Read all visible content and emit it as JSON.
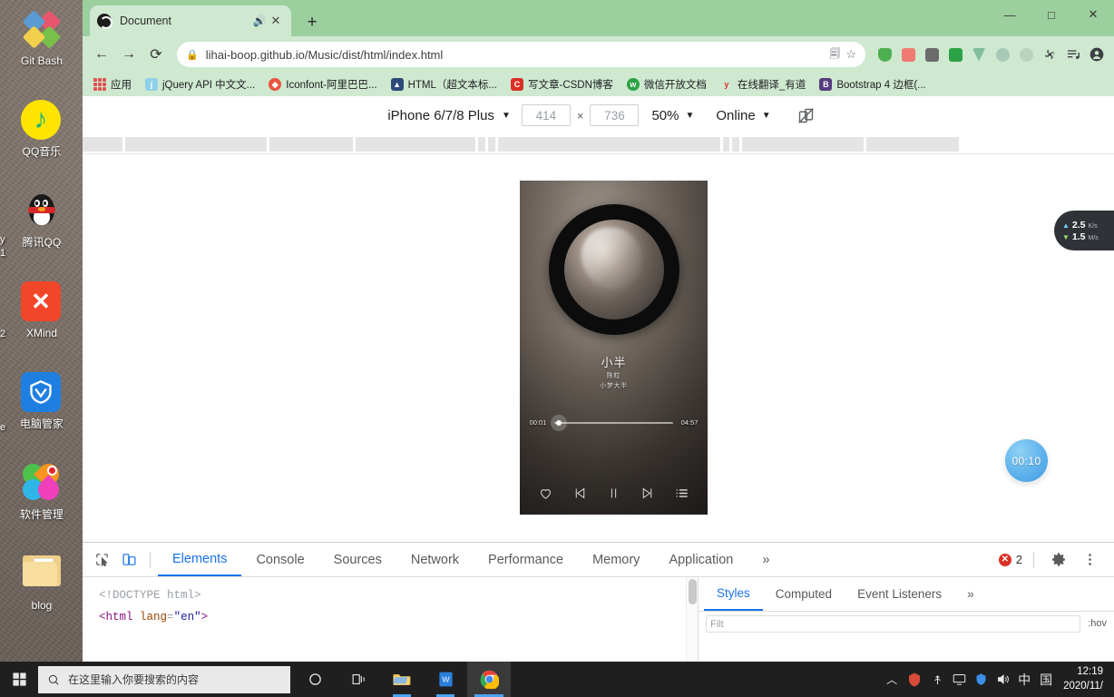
{
  "desktop": {
    "icons": [
      {
        "name": "git-bash",
        "label": "Git Bash"
      },
      {
        "name": "qq-music",
        "label": "QQ音乐"
      },
      {
        "name": "tencent-qq",
        "label": "腾讯QQ"
      },
      {
        "name": "xmind",
        "label": "XMind"
      },
      {
        "name": "pc-manager",
        "label": "电脑管家"
      },
      {
        "name": "software-manager",
        "label": "软件管理"
      },
      {
        "name": "blog-folder",
        "label": "blog"
      }
    ],
    "stray_labels": [
      "y",
      "1",
      "2",
      "e"
    ]
  },
  "overlays": {
    "network": {
      "upload_value": "2.5",
      "upload_unit": "K/s",
      "download_value": "1.5",
      "download_unit": "M/s"
    },
    "timer": {
      "value": "00:10"
    }
  },
  "browser": {
    "tab": {
      "title": "Document",
      "audio_icon": "speaker-icon",
      "close_icon": "close-icon"
    },
    "new_tab_label": "+",
    "window_controls": {
      "minimize": "—",
      "maximize": "□",
      "close": "✕"
    },
    "nav": {
      "back": "←",
      "forward": "→",
      "reload": "⟳"
    },
    "omnibox": {
      "lock_icon": "lock-icon",
      "url": "lihai-boop.github.io/Music/dist/html/index.html",
      "translate_icon": "translate-icon",
      "star_icon": "star-icon"
    },
    "extensions": [
      {
        "name": "adguard-icon",
        "color": "#4caf50"
      },
      {
        "name": "bookmark-ext-icon",
        "color": "#ef7b72"
      },
      {
        "name": "search-ext-icon",
        "color": "#6b6b6b"
      },
      {
        "name": "wechat-ext-icon",
        "color": "#2ba245"
      },
      {
        "name": "vue-devtools-icon",
        "color": "#7fbf9a"
      },
      {
        "name": "react-devtools-icon",
        "color": "#a9c9b8"
      },
      {
        "name": "generic-ext-icon",
        "color": "#b9d3bd"
      },
      {
        "name": "puzzle-icon",
        "color": "#3c4043"
      },
      {
        "name": "media-list-icon",
        "color": "#3c4043"
      },
      {
        "name": "profile-avatar-icon",
        "color": "#3c4043"
      }
    ],
    "bookmarks": [
      {
        "name": "apps",
        "label": "应用",
        "icon": "apps-grid-icon",
        "color": "#e0534f"
      },
      {
        "name": "jquery-api",
        "label": "jQuery API 中文文...",
        "icon": "jquery-icon",
        "color": "#8fd0e8"
      },
      {
        "name": "iconfont",
        "label": "Iconfont-阿里巴巴...",
        "icon": "iconfont-icon",
        "color": "#e8543f"
      },
      {
        "name": "html-mdn",
        "label": "HTML（超文本标...",
        "icon": "html-icon",
        "color": "#2d4a7a"
      },
      {
        "name": "csdn",
        "label": "写文章-CSDN博客",
        "icon": "csdn-icon",
        "color": "#d93025"
      },
      {
        "name": "wechat-docs",
        "label": "微信开放文档",
        "icon": "wechat-icon",
        "color": "#2ba245"
      },
      {
        "name": "youdao",
        "label": "在线翻译_有道",
        "icon": "youdao-icon",
        "color": "#d93025"
      },
      {
        "name": "bootstrap",
        "label": "Bootstrap 4 边框(...",
        "icon": "bootstrap-icon",
        "color": "#563d7c"
      }
    ]
  },
  "device_toolbar": {
    "device": "iPhone 6/7/8 Plus",
    "width": "414",
    "height": "736",
    "separator": "×",
    "zoom": "50%",
    "throttling": "Online",
    "rotate_icon": "rotate-device-icon"
  },
  "player": {
    "title": "小半",
    "artist": "陈粒",
    "album": "小梦大半",
    "current_time": "00:01",
    "total_time": "04:57",
    "progress_percent": 1,
    "controls": [
      {
        "name": "favorite-button",
        "icon": "heart-icon"
      },
      {
        "name": "previous-button",
        "icon": "skip-previous-icon"
      },
      {
        "name": "play-pause-button",
        "icon": "pause-icon"
      },
      {
        "name": "next-button",
        "icon": "skip-next-icon"
      },
      {
        "name": "playlist-button",
        "icon": "playlist-icon"
      }
    ]
  },
  "devtools": {
    "inspect_icon": "inspect-element-icon",
    "device_toggle_icon": "device-toolbar-icon",
    "tabs": [
      {
        "name": "elements",
        "label": "Elements",
        "active": true
      },
      {
        "name": "console",
        "label": "Console",
        "active": false
      },
      {
        "name": "sources",
        "label": "Sources",
        "active": false
      },
      {
        "name": "network",
        "label": "Network",
        "active": false
      },
      {
        "name": "performance",
        "label": "Performance",
        "active": false
      },
      {
        "name": "memory",
        "label": "Memory",
        "active": false
      },
      {
        "name": "application",
        "label": "Application",
        "active": false
      }
    ],
    "more_tabs_label": "»",
    "error_count": "2",
    "settings_icon": "gear-icon",
    "menu_icon": "kebab-menu-icon",
    "dom": {
      "line1": "<!DOCTYPE html>",
      "line2_open": "<",
      "line2_tag": "html",
      "line2_attr": " lang",
      "line2_eq": "=",
      "line2_val": "\"en\"",
      "line2_close": ">"
    },
    "sidebar": {
      "tabs": [
        {
          "name": "styles",
          "label": "Styles",
          "active": true
        },
        {
          "name": "computed",
          "label": "Computed",
          "active": false
        },
        {
          "name": "event-listeners",
          "label": "Event Listeners",
          "active": false
        }
      ],
      "more_label": "»",
      "filter_placeholder": "Filt",
      "hov_label": ":hov"
    }
  },
  "taskbar": {
    "start_icon": "windows-start-icon",
    "search_placeholder": "在这里输入你要搜索的内容",
    "search_icon": "search-circle-icon",
    "apps": [
      {
        "name": "cortana-taskview",
        "icon": "task-view-icon"
      },
      {
        "name": "file-explorer",
        "icon": "folder-icon"
      },
      {
        "name": "wps-office",
        "icon": "wps-icon"
      },
      {
        "name": "google-chrome",
        "icon": "chrome-icon"
      }
    ],
    "tray": {
      "chevron": "︿",
      "icons": [
        "security-shield-icon",
        "usb-icon",
        "monitor-icon",
        "shield-icon",
        "volume-icon"
      ],
      "ime": "中",
      "ime_box": "国",
      "time": "12:19",
      "date": "2020/11/"
    }
  }
}
